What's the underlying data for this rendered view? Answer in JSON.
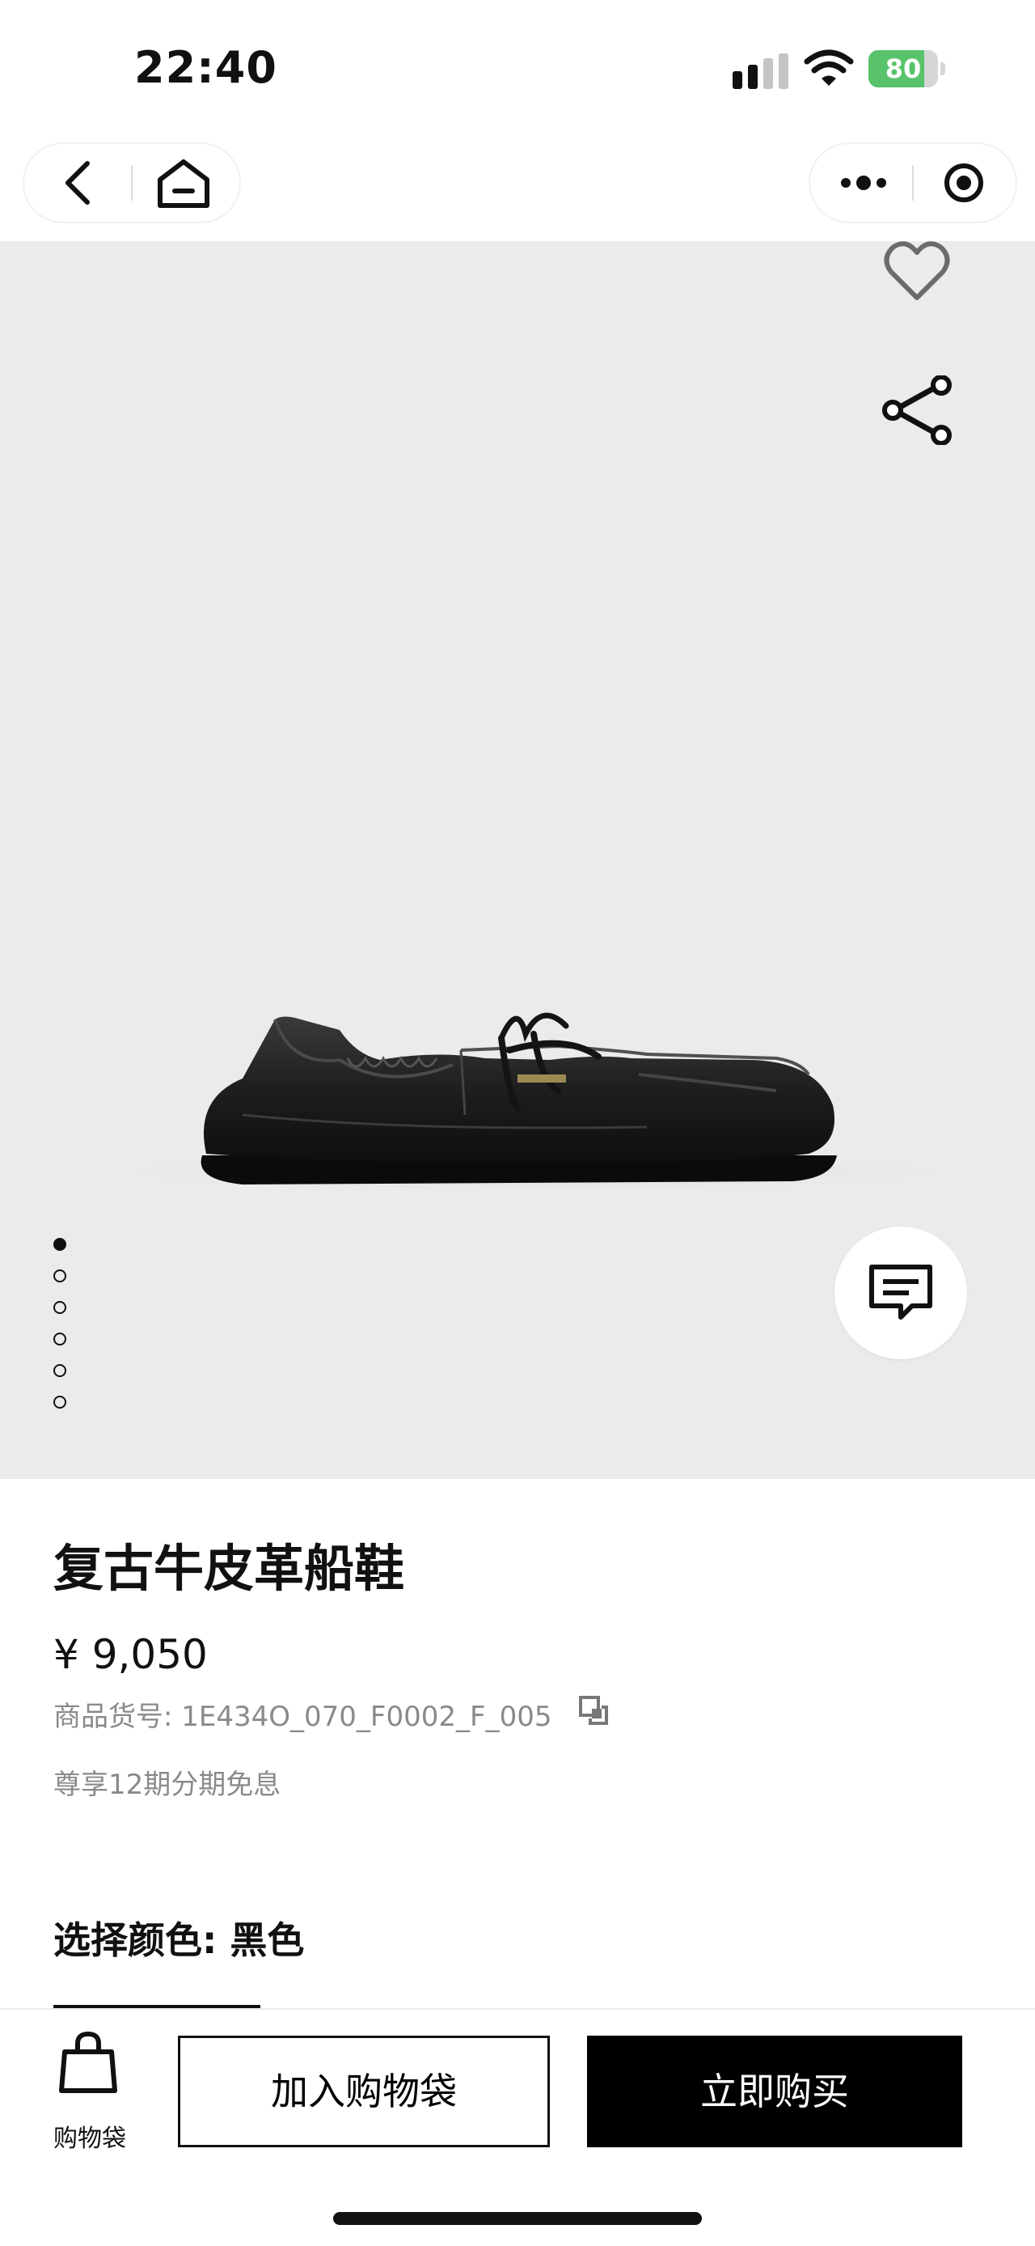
{
  "status_bar": {
    "time": "22:40",
    "battery": "80",
    "battery_level": 0.8,
    "battery_color": "#58c36a"
  },
  "product": {
    "title": "复古牛皮革船鞋",
    "price": "¥ 9,050",
    "sku": "商品货号: 1E434O_070_F0002_F_005",
    "installment": "尊享12期分期免息",
    "color_label": "选择颜色: 黑色"
  },
  "gallery": {
    "image_count": 6,
    "current_index": 1,
    "background": "#ebebeb"
  },
  "bottom_bar": {
    "bag_label": "购物袋",
    "add_to_bag": "加入购物袋",
    "buy_now": "立即购买"
  },
  "icons": [
    "back-icon",
    "home-icon",
    "more-icon",
    "target-icon",
    "heart-icon",
    "share-icon",
    "chat-icon",
    "copy-icon",
    "shopping-bag-icon"
  ]
}
